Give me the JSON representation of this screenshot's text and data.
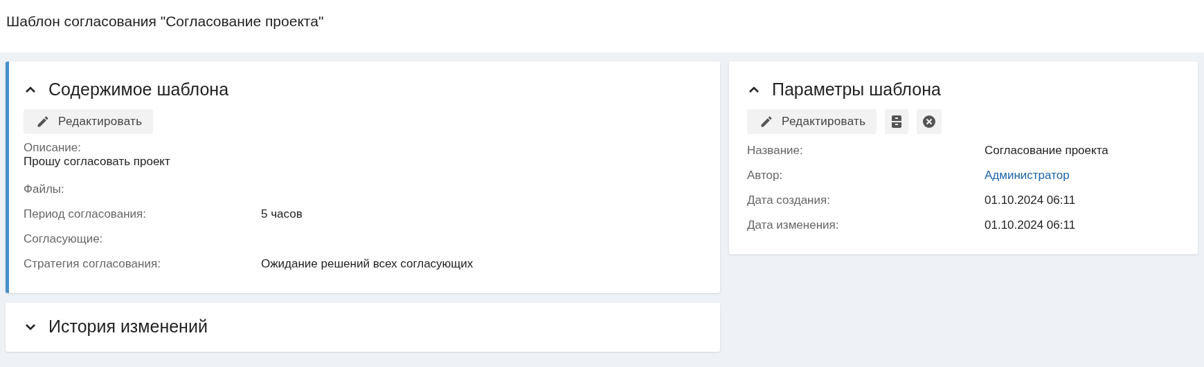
{
  "page_title": "Шаблон согласования \"Согласование проекта\"",
  "content_panel": {
    "title": "Содержимое шаблона",
    "expanded": true,
    "highlighted": true,
    "actions": [
      {
        "kind": "edit",
        "label": "Редактировать"
      }
    ],
    "fields": [
      {
        "kind": "stacked",
        "label": "Описание:",
        "value": "Прошу согласовать проект"
      },
      {
        "kind": "inline",
        "label": "Файлы:"
      },
      {
        "kind": "inline",
        "label": "Период согласования:",
        "value": "5 часов"
      },
      {
        "kind": "inline",
        "label": "Согласующие:"
      },
      {
        "kind": "inline",
        "label": "Стратегия согласования:",
        "value": "Ожидание решений всех согласующих"
      }
    ]
  },
  "history_panel": {
    "title": "История изменений",
    "expanded": false,
    "highlighted": false
  },
  "params_panel": {
    "title": "Параметры шаблона",
    "expanded": true,
    "highlighted": false,
    "actions": [
      {
        "kind": "edit",
        "label": "Редактировать"
      },
      {
        "kind": "archive"
      },
      {
        "kind": "delete"
      }
    ],
    "fields": [
      {
        "kind": "inline",
        "label": "Название:",
        "value": "Согласование проекта"
      },
      {
        "kind": "link",
        "label": "Автор:",
        "value": "Администратор"
      },
      {
        "kind": "inline",
        "label": "Дата создания:",
        "value": "01.10.2024 06:11"
      },
      {
        "kind": "inline",
        "label": "Дата изменения:",
        "value": "01.10.2024 06:11"
      }
    ]
  }
}
